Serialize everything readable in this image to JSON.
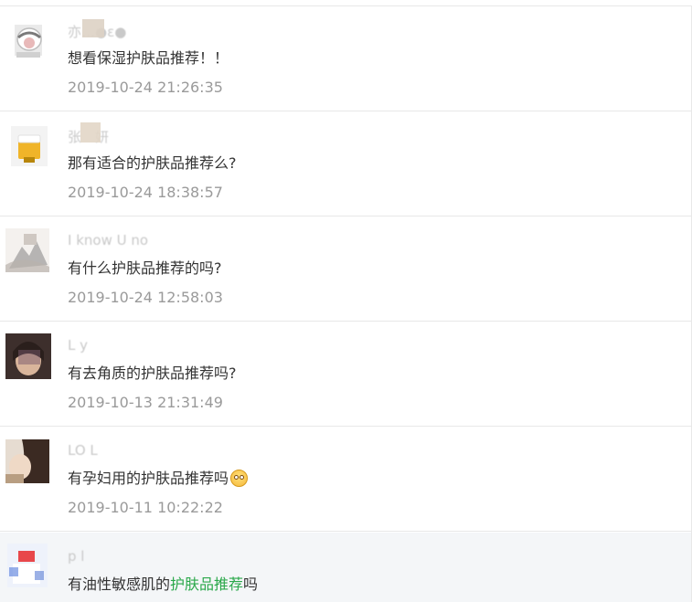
{
  "comments": [
    {
      "name": "亦…●ε●",
      "message": "想看保湿护肤品推荐！！",
      "time": "2019-10-24 21:26:35"
    },
    {
      "name": "张 妍",
      "message": "那有适合的护肤品推荐么?",
      "time": "2019-10-24 18:38:57"
    },
    {
      "name": "I know U no",
      "message": "有什么护肤品推荐的吗?",
      "time": "2019-10-24 12:58:03"
    },
    {
      "name": "L   y",
      "message": "有去角质的护肤品推荐吗?",
      "time": "2019-10-13 21:31:49"
    },
    {
      "name": "LO  L",
      "message": "有孕妇用的护肤品推荐吗",
      "emoji": "flushed-face",
      "time": "2019-10-11 10:22:22"
    },
    {
      "name": "p   l",
      "message_prefix": "有油性敏感肌的",
      "message_link": "护肤品推荐",
      "message_suffix": "吗",
      "link_color": "#2aa84a"
    }
  ]
}
